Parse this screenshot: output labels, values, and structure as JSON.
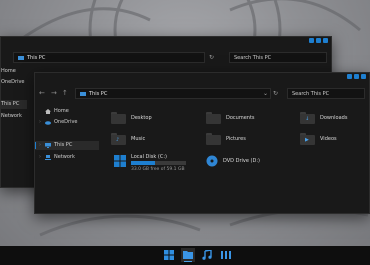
{
  "back_window": {
    "breadcrumb": "This PC",
    "search_placeholder": "Search This PC",
    "sidebar": [
      {
        "label": "Home"
      },
      {
        "label": "OneDrive"
      },
      {
        "label": "This PC"
      },
      {
        "label": "Network"
      }
    ]
  },
  "front_window": {
    "nav": {
      "back": "←",
      "forward": "→",
      "up": "↑",
      "dropdown": "⌄",
      "refresh": "↻"
    },
    "breadcrumb": "This PC",
    "search_placeholder": "Search This PC",
    "sidebar": [
      {
        "label": "Home",
        "icon": "home-icon"
      },
      {
        "label": "OneDrive",
        "icon": "cloud-icon"
      },
      {
        "label": "This PC",
        "icon": "computer-icon",
        "selected": true
      },
      {
        "label": "Network",
        "icon": "network-icon"
      }
    ],
    "folders": [
      {
        "name": "Desktop",
        "icon": "desktop-folder-icon"
      },
      {
        "name": "Documents",
        "icon": "documents-folder-icon"
      },
      {
        "name": "Downloads",
        "icon": "downloads-folder-icon"
      },
      {
        "name": "Music",
        "icon": "music-folder-icon"
      },
      {
        "name": "Pictures",
        "icon": "pictures-folder-icon"
      },
      {
        "name": "Videos",
        "icon": "videos-folder-icon"
      }
    ],
    "drives": [
      {
        "name": "Local Disk (C:)",
        "free_text": "33.0 GB free of 59.1 GB",
        "used_fraction": 0.44,
        "icon": "windows-drive-icon"
      },
      {
        "name": "DVD Drive (D:)",
        "icon": "dvd-drive-icon"
      }
    ]
  },
  "taskbar": {
    "items": [
      {
        "name": "start",
        "icon": "windows-logo-icon"
      },
      {
        "name": "file-explorer",
        "icon": "folder-icon",
        "active": true
      },
      {
        "name": "music",
        "icon": "music-note-icon"
      },
      {
        "name": "apps",
        "icon": "app-grid-icon"
      }
    ]
  },
  "colors": {
    "accent": "#1e7fd0",
    "window_bg": "#191919",
    "taskbar_bg": "#0e0e0e"
  }
}
